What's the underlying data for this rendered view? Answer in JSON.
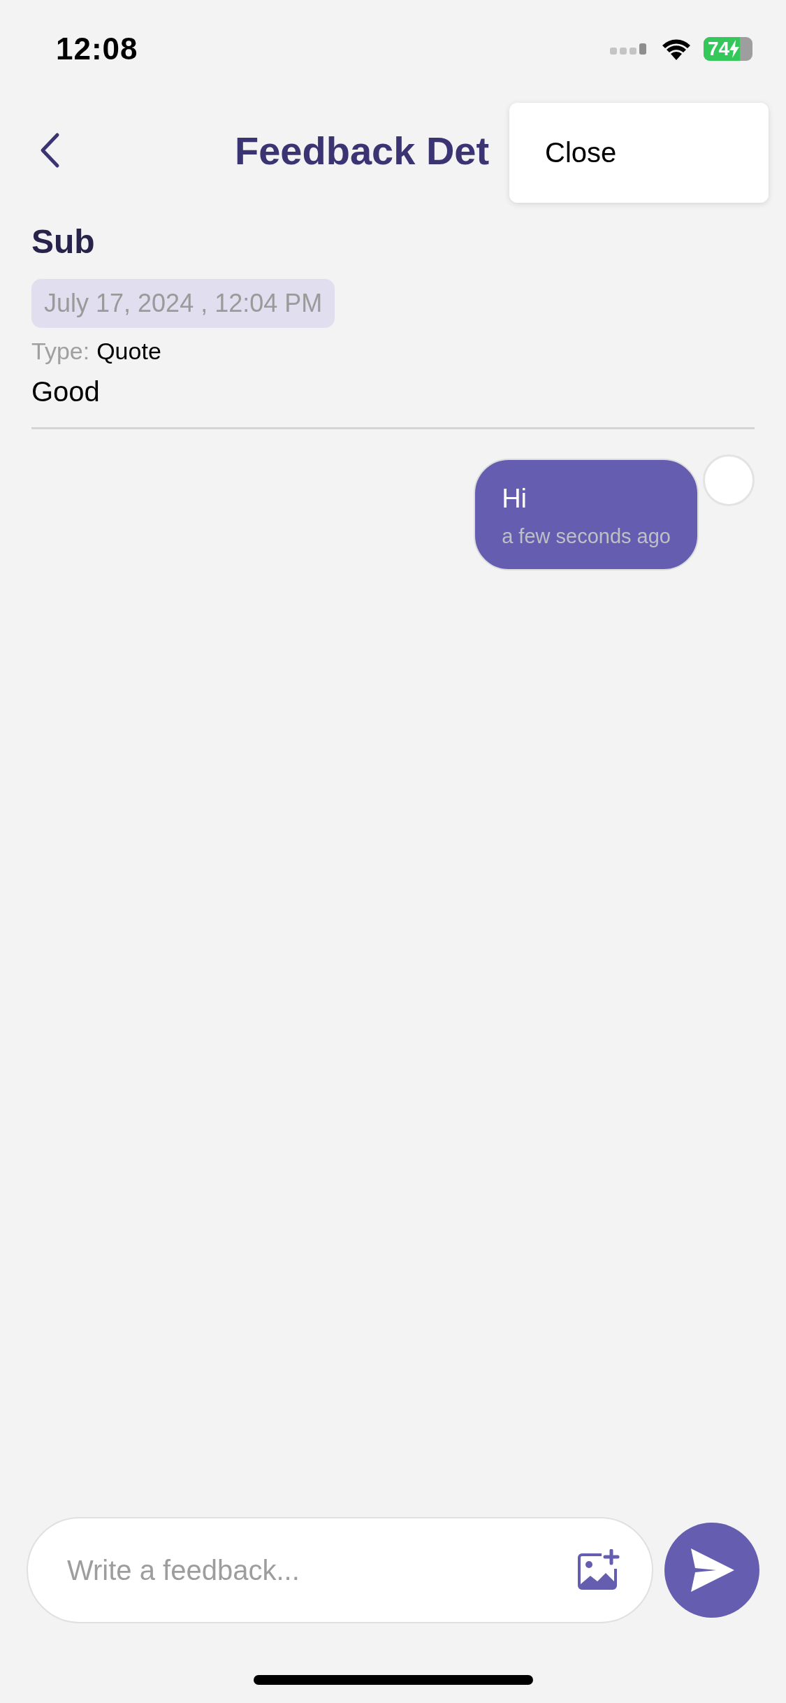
{
  "status_bar": {
    "time": "12:08",
    "battery": "74",
    "charging": true
  },
  "header": {
    "title": "Feedback Det"
  },
  "menu": {
    "items": [
      {
        "label": "Close"
      }
    ]
  },
  "feedback": {
    "subject": "Sub",
    "date": "July 17, 2024 , 12:04 PM",
    "type_label": "Type:",
    "type_value": "Quote",
    "body": "Good"
  },
  "messages": [
    {
      "text": "Hi",
      "time": "a few seconds ago",
      "outgoing": true
    }
  ],
  "composer": {
    "placeholder": "Write a feedback..."
  }
}
